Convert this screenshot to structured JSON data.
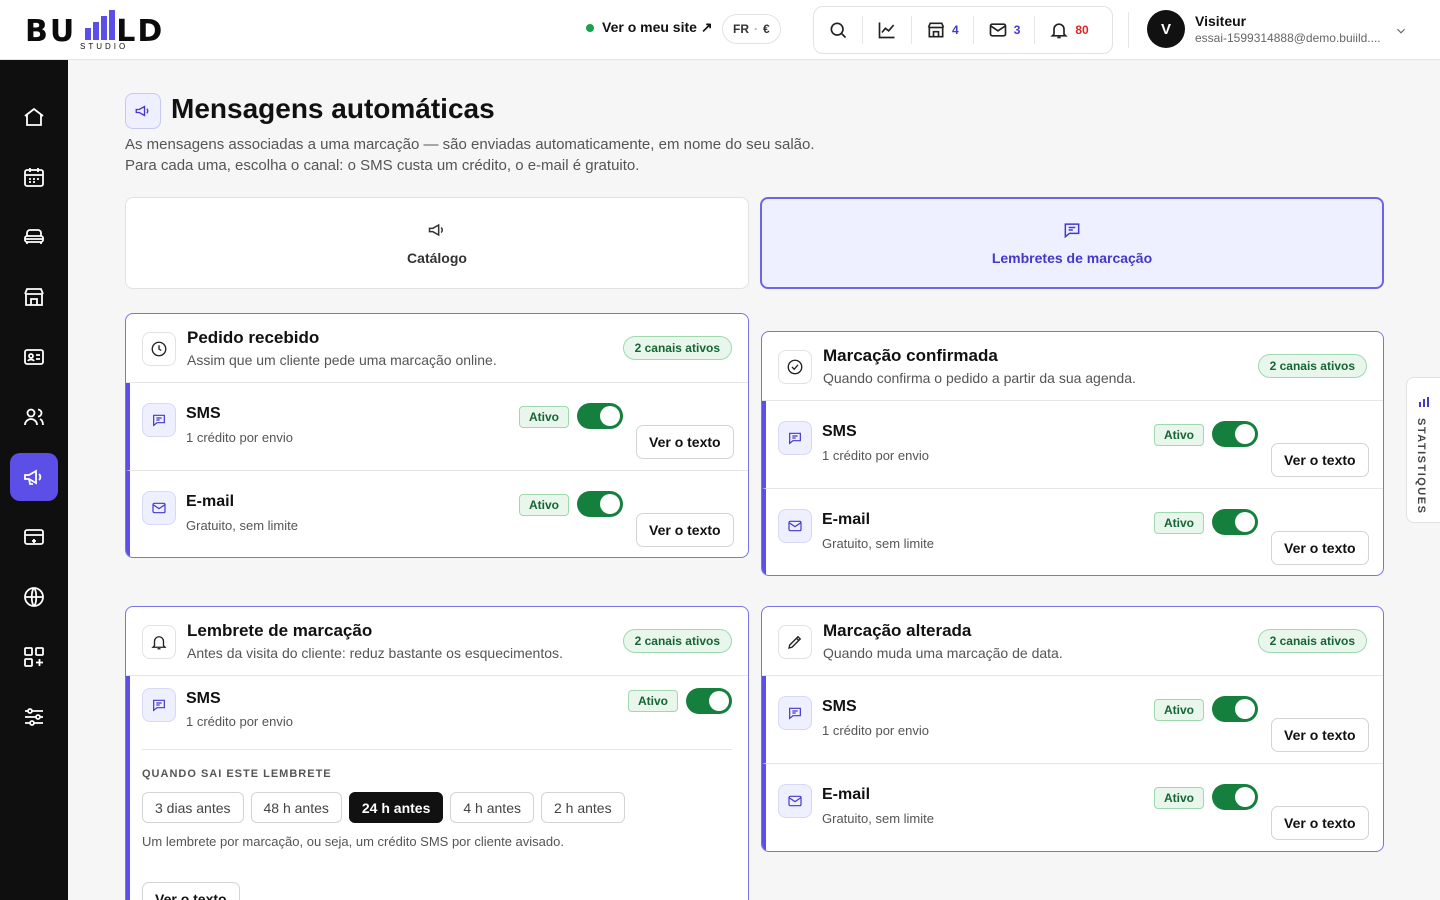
{
  "brand": {
    "logo_text": "BUILD",
    "logo_sub": "STUDIO",
    "logo_parts": [
      "BU",
      "LD"
    ]
  },
  "header": {
    "site_link": "Ver o meu site ↗",
    "lang": "FR",
    "currency": "€",
    "counts": {
      "shop": "4",
      "mail": "3",
      "notifications": "80"
    },
    "user": {
      "name": "Visiteur",
      "email": "essai-1599314888@demo.buiild....",
      "initial": "V"
    }
  },
  "page": {
    "title": "Mensagens automáticas",
    "description_1": "As mensagens associadas a uma marcação — são enviadas automaticamente, em nome do seu salão.",
    "description_2": "Para cada uma, escolha o canal: o SMS custa um crédito, o e-mail é gratuito."
  },
  "tabs": [
    {
      "label": "Catálogo",
      "active": false
    },
    {
      "label": "Lembretes de marcação",
      "active": true
    }
  ],
  "cards": {
    "pedido": {
      "title": "Pedido recebido",
      "subtitle": "Assim que um cliente pede uma marcação online.",
      "badge": "2 canais ativos",
      "rows": [
        {
          "title": "SMS",
          "subtitle": "1 crédito por envio",
          "status": "Ativo",
          "button": "Ver o texto"
        },
        {
          "title": "E-mail",
          "subtitle": "Gratuito, sem limite",
          "status": "Ativo",
          "button": "Ver o texto"
        }
      ]
    },
    "confirmada": {
      "title": "Marcação confirmada",
      "subtitle": "Quando confirma o pedido a partir da sua agenda.",
      "badge": "2 canais ativos",
      "rows": [
        {
          "title": "SMS",
          "subtitle": "1 crédito por envio",
          "status": "Ativo",
          "button": "Ver o texto"
        },
        {
          "title": "E-mail",
          "subtitle": "Gratuito, sem limite",
          "status": "Ativo",
          "button": "Ver o texto"
        }
      ]
    },
    "lembrete": {
      "title": "Lembrete de marcação",
      "subtitle": "Antes da visita do cliente: reduz bastante os esquecimentos.",
      "badge": "2 canais ativos",
      "row": {
        "title": "SMS",
        "subtitle": "1 crédito por envio",
        "status": "Ativo"
      },
      "when_label": "QUANDO SAI ESTE LEMBRETE",
      "options": [
        "3 dias antes",
        "48 h antes",
        "24 h antes",
        "4 h antes",
        "2 h antes"
      ],
      "selected": "24 h antes",
      "note": "Um lembrete por marcação, ou seja, um crédito SMS por cliente avisado.",
      "button": "Ver o texto"
    },
    "alterada": {
      "title": "Marcação alterada",
      "subtitle": "Quando muda uma marcação de data.",
      "badge": "2 canais ativos",
      "rows": [
        {
          "title": "SMS",
          "subtitle": "1 crédito por envio",
          "status": "Ativo",
          "button": "Ver o texto"
        },
        {
          "title": "E-mail",
          "subtitle": "Gratuito, sem limite",
          "status": "Ativo",
          "button": "Ver o texto"
        }
      ]
    }
  },
  "side_tab": {
    "label": "STATISTIQUES"
  },
  "colors": {
    "accent": "#5b4fe8",
    "success": "#15803d",
    "sidebar": "#0f0f10"
  }
}
